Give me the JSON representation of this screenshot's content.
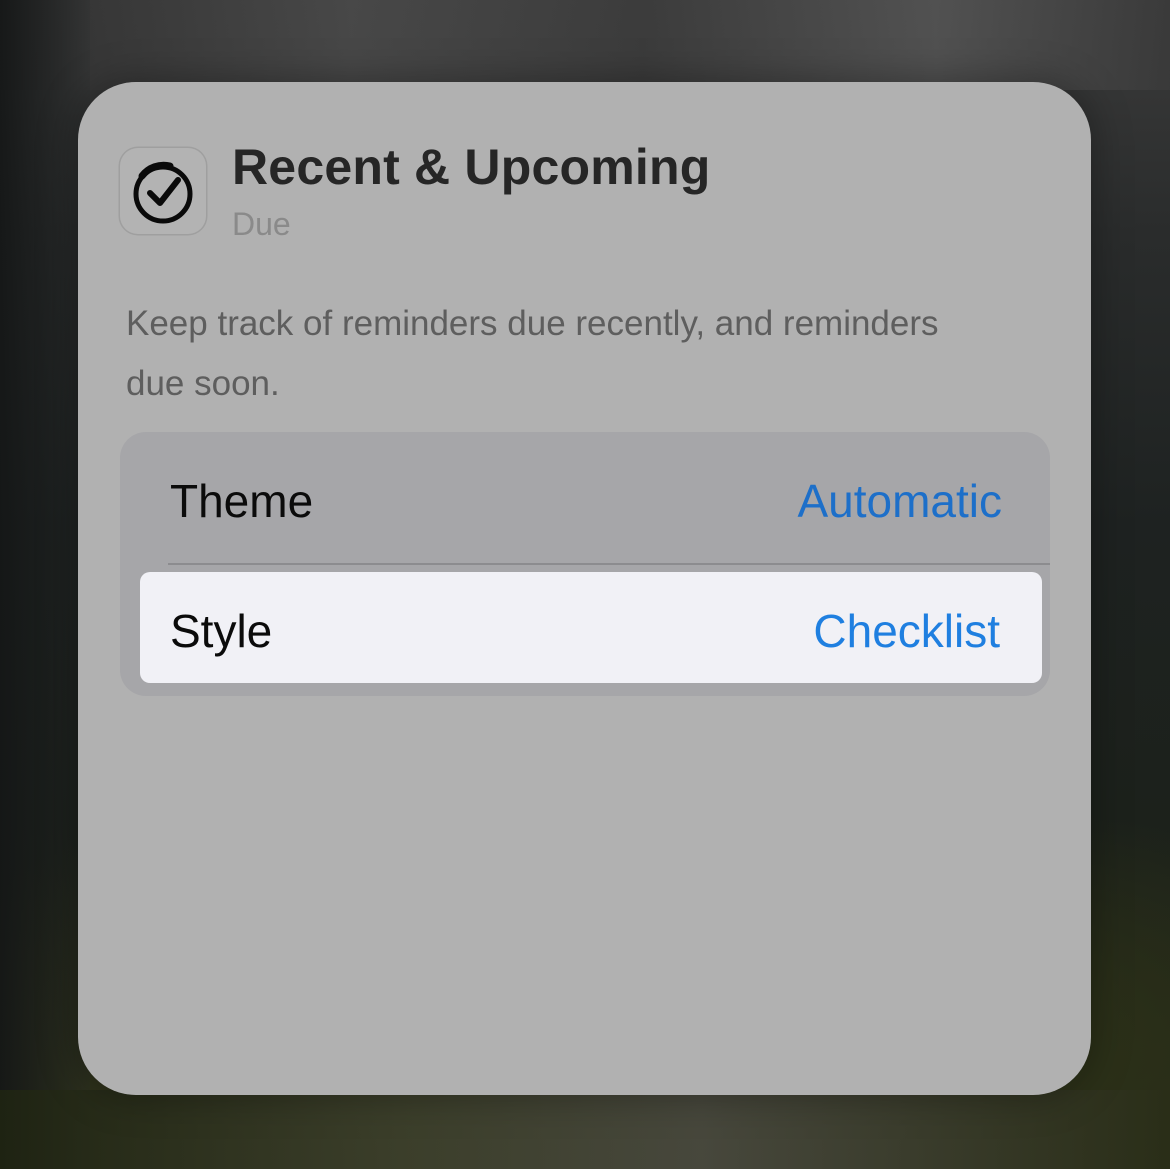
{
  "widget": {
    "title": "Recent & Upcoming",
    "app_name": "Due",
    "icon": "checkmark-circle-icon",
    "description": "Keep track of reminders due recently, and reminders due soon."
  },
  "settings": {
    "theme": {
      "label": "Theme",
      "value": "Automatic"
    },
    "style": {
      "label": "Style",
      "value": "Checklist"
    }
  },
  "colors": {
    "card_background": "#b1b1b1",
    "group_background": "#a6a6a9",
    "highlighted_row": "#f1f1f6",
    "value_accent": "#1d6fc9"
  }
}
